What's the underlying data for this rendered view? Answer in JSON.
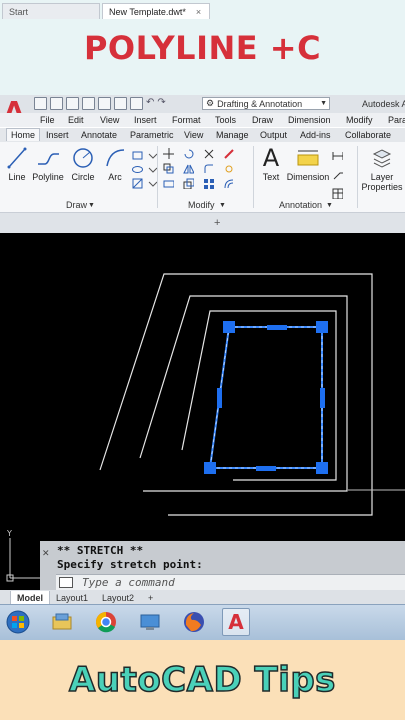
{
  "banner": {
    "title": "POLYLINE +C",
    "footer": "AutoCAD Tips"
  },
  "titlebar": {
    "workspace": "Drafting & Annotation",
    "app_name": "Autodesk A"
  },
  "menu": [
    "File",
    "Edit",
    "View",
    "Insert",
    "Format",
    "Tools",
    "Draw",
    "Dimension",
    "Modify",
    "Para"
  ],
  "ribbon_tabs": [
    "Home",
    "Insert",
    "Annotate",
    "Parametric",
    "View",
    "Manage",
    "Output",
    "Add-ins",
    "Collaborate"
  ],
  "ribbon": {
    "draw_tools": [
      "Line",
      "Polyline",
      "Circle",
      "Arc"
    ],
    "text_label": "Text",
    "dimension_label": "Dimension",
    "layer_label_1": "Layer",
    "layer_label_2": "Properties",
    "panels": [
      "Draw",
      "Modify",
      "Annotation"
    ]
  },
  "doc_tabs": {
    "start": "Start",
    "current": "New Template.dwt*"
  },
  "command": {
    "line1": "** STRETCH **",
    "line2": "Specify stretch point:",
    "placeholder": "Type a command"
  },
  "layout_tabs": [
    "Model",
    "Layout1",
    "Layout2"
  ],
  "colors": {
    "accent_red": "#d6303a",
    "grip_blue": "#1e6ff0",
    "selection_blue": "#3f8cff",
    "canvas": "#000000",
    "footer_teal": "#4ad1b9"
  }
}
